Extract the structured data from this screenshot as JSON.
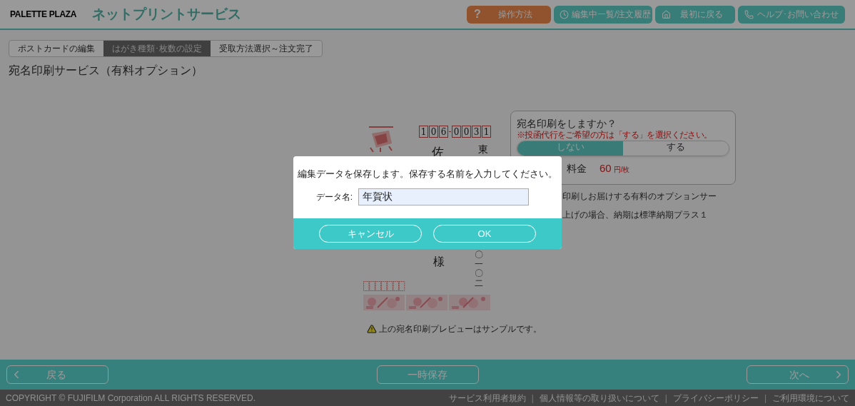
{
  "header": {
    "brand": "PALETTE PLAZA",
    "service": "ネットプリントサービス",
    "buttons": [
      {
        "kind": "help",
        "label": "操作方法",
        "icon": "?"
      },
      {
        "kind": "history",
        "label": "編集中一覧/注文履歴"
      },
      {
        "kind": "home",
        "label": "最初に戻る"
      },
      {
        "kind": "contact",
        "label": "ヘルプ･お問い合わせ"
      }
    ]
  },
  "steps": [
    {
      "label": "ポストカードの編集",
      "selected": false
    },
    {
      "label": "はがき種類･枚数の設定",
      "selected": true
    },
    {
      "label": "受取方法選択～注文完了",
      "selected": false
    }
  ],
  "page_title": "宛名印刷サービス（有料オプション）",
  "preview": {
    "zip_digits": [
      "1",
      "0",
      "6",
      "0",
      "0",
      "3",
      "1"
    ],
    "name_char": "佐",
    "address_top": "東",
    "address_bottom": "〇一〇二",
    "honorific": "様"
  },
  "option_panel": {
    "question": "宛名印刷をしますか？",
    "note": "※投函代行をご希望の方は「する」を選択ください。",
    "choices": [
      {
        "label": "しない",
        "selected": true
      },
      {
        "label": "する",
        "selected": false
      }
    ],
    "fee_label": "料金",
    "fee_value": "60",
    "fee_unit": "円/枚"
  },
  "description_lines": [
    "印刷しお届けする有料のオプションサー",
    "上げの場合、納期は標準納期プラス１"
  ],
  "sample_notice": "上の宛名印刷プレビューはサンプルです。",
  "nav": {
    "back": "戻る",
    "save": "一時保存",
    "next": "次へ"
  },
  "footer": {
    "copyright": "COPYRIGHT © FUJIFILM Corporation ALL RIGHTS RESERVED.",
    "links": [
      {
        "kind": "link",
        "text": "サービス利用者規約"
      },
      {
        "kind": "separator",
        "text": "|"
      },
      {
        "kind": "link",
        "text": "個人情報等の取り扱いについて"
      },
      {
        "kind": "separator",
        "text": "|"
      },
      {
        "kind": "link",
        "text": "プライバシーポリシー"
      },
      {
        "kind": "separator",
        "text": "|"
      },
      {
        "kind": "link",
        "text": "ご利用環境について"
      }
    ]
  },
  "dialog": {
    "message": "編集データを保存します。保存する名前を入力してください。",
    "field_label": "データ名:",
    "field_value": "年賀状",
    "buttons": [
      "キャンセル",
      "OK"
    ]
  }
}
